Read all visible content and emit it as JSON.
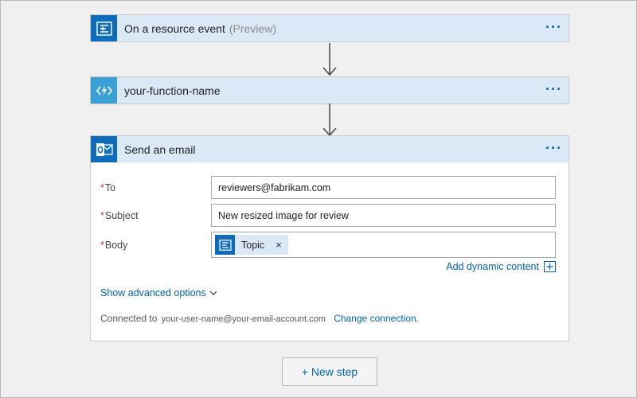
{
  "steps": [
    {
      "title": "On a resource event",
      "suffix": "(Preview)",
      "icon": "event-grid-icon"
    },
    {
      "title": "your-function-name",
      "suffix": "",
      "icon": "azure-function-icon"
    },
    {
      "title": "Send an email",
      "suffix": "",
      "icon": "outlook-icon"
    }
  ],
  "more_label": "···",
  "email_form": {
    "to": {
      "label": "To",
      "value": "reviewers@fabrikam.com"
    },
    "subject": {
      "label": "Subject",
      "value": "New resized image for review"
    },
    "body": {
      "label": "Body",
      "token_label": "Topic",
      "token_close": "×"
    },
    "required_marker": "*",
    "add_dynamic_content": "Add dynamic content",
    "show_advanced": "Show advanced options",
    "connected_prefix": "Connected to",
    "connected_account": "your-user-name@your-email-account.com",
    "change_connection": "Change connection."
  },
  "new_step_label": "+ New step",
  "colors": {
    "header_bg": "#dbe8f5",
    "icon_blue": "#0f6cbd",
    "function_blue": "#3aa0d6",
    "link": "#0063b1",
    "required": "#c0392b"
  }
}
